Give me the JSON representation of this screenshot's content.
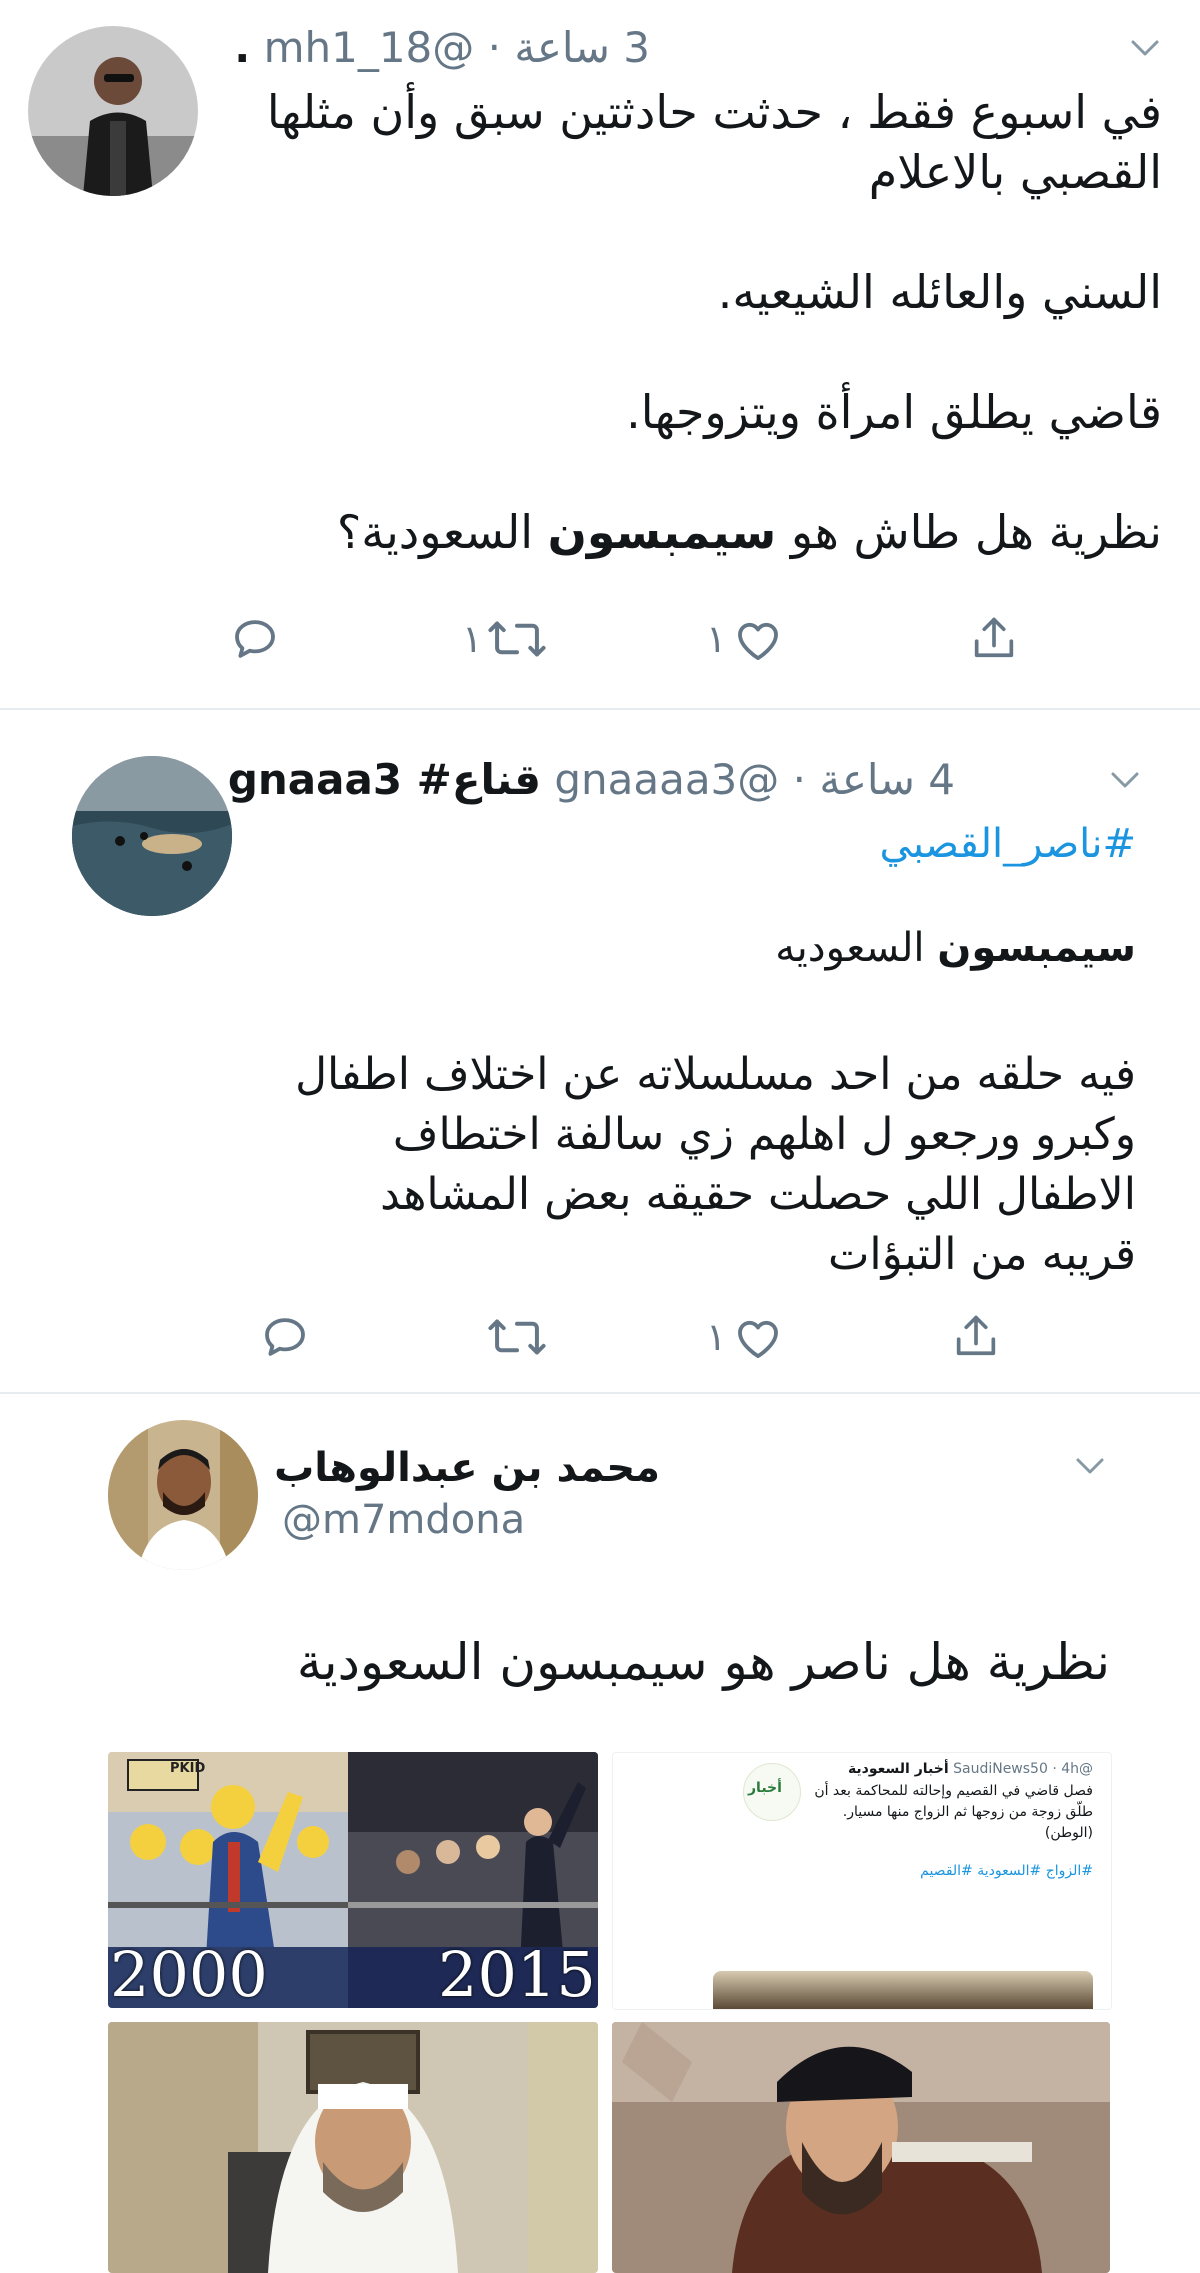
{
  "tweets": [
    {
      "handle": "@mh1_18",
      "time": "3 ساعة",
      "name": ".",
      "lines": [
        "في اسبوع فقط ، حدثت حادثتين سبق وأن مثلها",
        "القصبي بالاعلام",
        "السني والعائله الشيعيه.",
        "قاضي يطلق امرأة ويتزوجها."
      ],
      "last_line_pre": "نظرية هل طاش هو ",
      "last_line_bold": "سيمبسون",
      "last_line_post": " السعودية؟",
      "reply_count": "",
      "retweet_count": "١",
      "like_count": "١"
    },
    {
      "name": "قناع# gnaaa3",
      "handle": "@gnaaaa3",
      "time": "4 ساعة",
      "hashtag": "#ناصر_القصبي",
      "title_bold": "سيمبسون",
      "title_rest": " السعوديه",
      "lines": [
        "فيه حلقه من احد مسلسلاته  عن اختلاف اطفال",
        "وكبرو ورجعو ل اهلهم   زي سالفة اختطاف",
        "الاطفال اللي حصلت  حقيقه    بعض المشاهد",
        "قريبه من التبؤات"
      ],
      "retweet_count": "",
      "like_count": "١"
    },
    {
      "name": "محمد بن عبدالوهاب",
      "handle": "@m7mdona",
      "text": "نظرية هل ناصر هو سيمبسون السعودية",
      "media": {
        "year_left": "2000",
        "year_right": "2015",
        "sign": "PKID",
        "embed_account": "أخبار السعودية",
        "embed_handle": "@SaudiNews50 · 4h",
        "embed_text": "فصل قاضي في القصيم وإحالته للمحاكمة بعد أن طلّق زوجة من زوجها ثم الزواج منها مسيار.(الوطن)",
        "embed_tags": "#الزواج #السعودية #القصيم",
        "embed_logo": "أخبار"
      }
    }
  ],
  "icons": {
    "reply": "reply-icon",
    "retweet": "retweet-icon",
    "like": "heart-icon",
    "share": "share-icon",
    "more": "chevron-down-icon"
  },
  "colors": {
    "muted": "#657786",
    "link": "#1b95e0",
    "divider": "#e6ecf0"
  }
}
